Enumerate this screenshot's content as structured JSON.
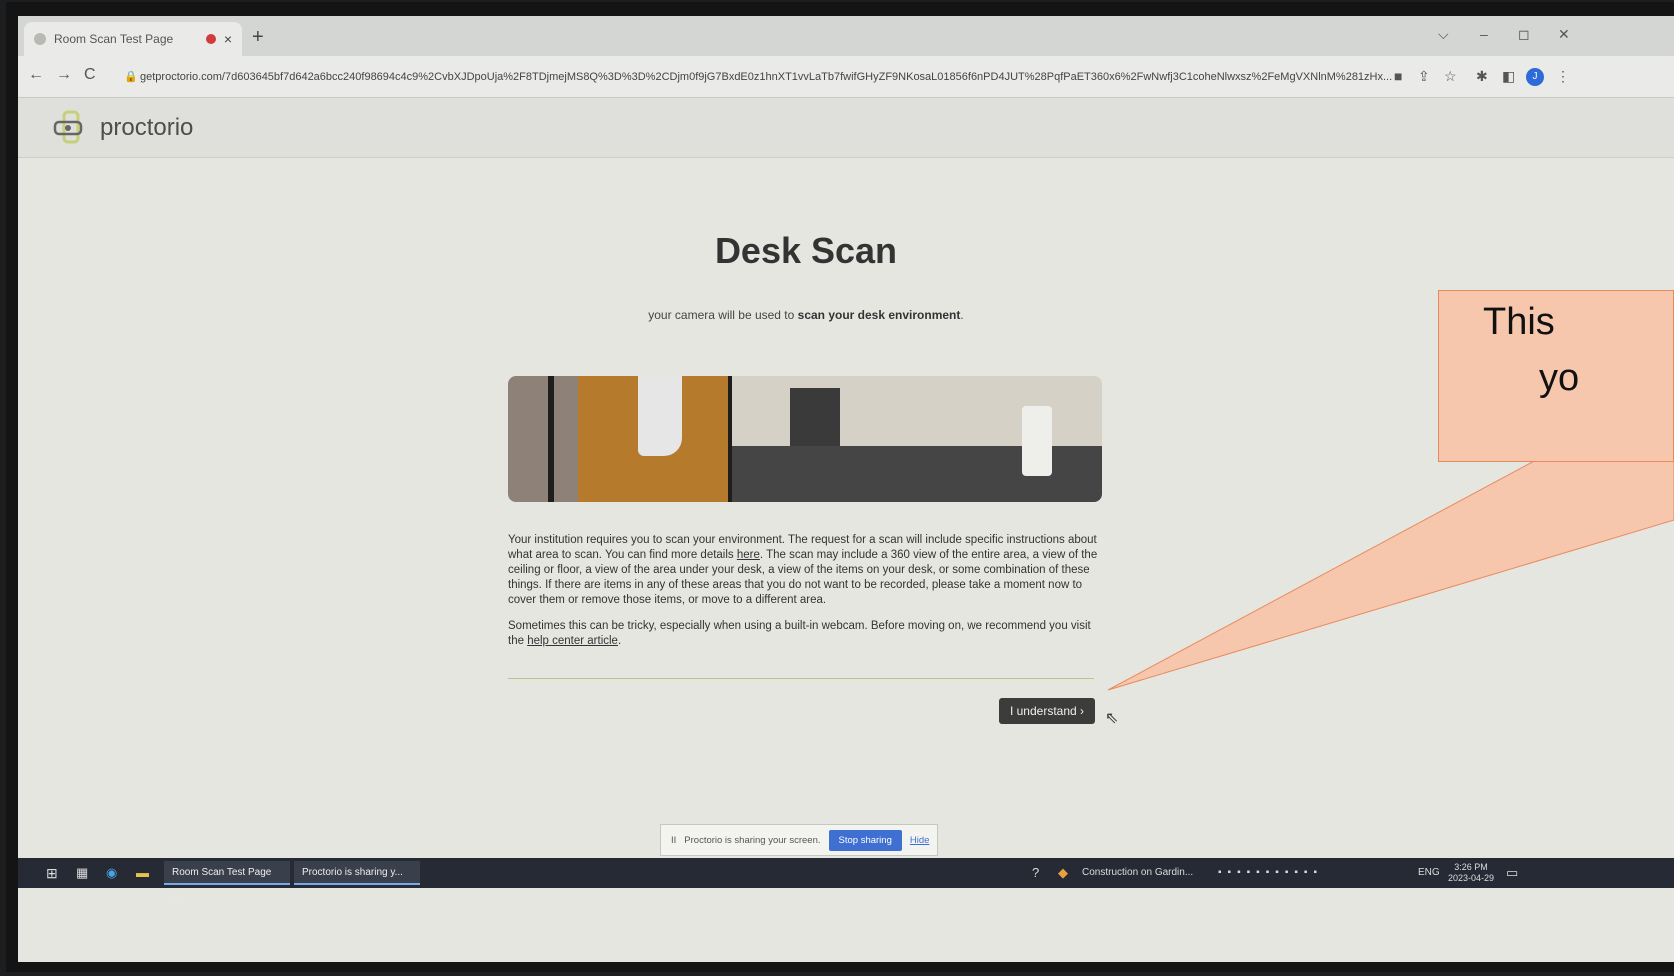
{
  "browser": {
    "tab_title": "Room Scan Test Page",
    "tab_close": "×",
    "new_tab": "+",
    "url": "getproctorio.com/7d603645bf7d642a6bcc240f98694c4c9%2CvbXJDpoUja%2F8TDjmejMS8Q%3D%3D%2CDjm0f9jG7BxdE0z1hnXT1vvLaTb7fwifGHyZF9NKosaL01856f6nPD4JUT%28PqfPaET360x6%2FwNwfj3C1coheNlwxsz%2FeMgVXNlnM%281zHx...",
    "nav_back": "←",
    "nav_forward": "→",
    "nav_reload": "C",
    "lock": "🔒",
    "win_min": "–",
    "win_max": "◻",
    "win_close": "✕",
    "win_tabs": "⌵",
    "avatar_letter": "J"
  },
  "app": {
    "brand": "proctorio"
  },
  "page": {
    "title": "Desk Scan",
    "subtitle_prefix": "your camera will be used to ",
    "subtitle_bold": "scan your desk environment",
    "subtitle_suffix": ".",
    "para1_a": "Your institution requires you to scan your environment. The request for a scan will include specific instructions about what area to scan. You can find more details ",
    "para1_link": "here",
    "para1_b": ". The scan may include a 360 view of the entire area, a view of the ceiling or floor, a view of the area under your desk, a view of the items on your desk, or some combination of these things. If there are items in any of these areas that you do not want to be recorded, please take a moment now to cover them or remove those items, or move to a different area.",
    "para2_a": "Sometimes this can be tricky, especially when using a built-in webcam. Before moving on, we recommend you visit the ",
    "para2_link": "help center article",
    "para2_b": ".",
    "button_label": "I understand ›"
  },
  "sharebar": {
    "pause_icon": "II",
    "message": "Proctorio is sharing your screen.",
    "stop_label": "Stop sharing",
    "hide_label": "Hide"
  },
  "taskbar": {
    "app1": "Room Scan Test Page ...",
    "app2": "Proctorio is sharing y...",
    "notification": "Construction on Gardin...",
    "lang": "ENG",
    "time": "3:26 PM",
    "date": "2023-04-29"
  },
  "callout": {
    "line1": "This",
    "line2": "yo"
  },
  "colors": {
    "accent": "#3f6fd1",
    "button_bg": "#3c3d3a",
    "callout_fill": "#f6c6ad",
    "callout_stroke": "#e88a5e"
  }
}
